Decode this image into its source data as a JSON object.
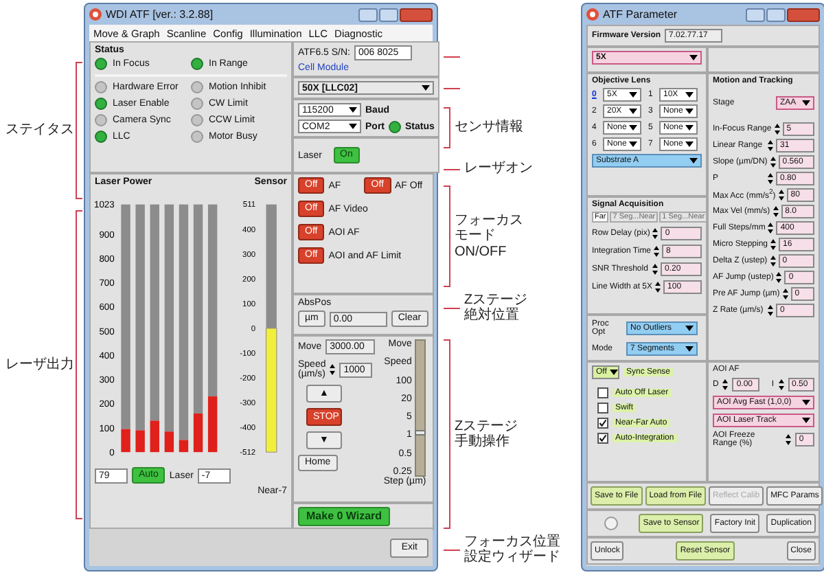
{
  "annotations_left": [
    {
      "label": "ステイタス"
    },
    {
      "label": "レーザ出力"
    }
  ],
  "annotations_middle": [
    {
      "lines": [
        "センサ情報"
      ],
      "kind": "bracket"
    },
    {
      "lines": [
        "レーザオン"
      ],
      "kind": "line"
    },
    {
      "lines": [
        "フォーカス",
        "モード",
        "ON/OFF"
      ],
      "kind": "bracket"
    },
    {
      "lines": [
        "Zステージ",
        "絶対位置"
      ],
      "kind": "line"
    },
    {
      "lines": [
        "Zステージ",
        "手動操作"
      ],
      "kind": "bracket"
    },
    {
      "lines": [
        "フォーカス位置",
        "設定ウィザード"
      ],
      "kind": "line"
    }
  ],
  "main_window": {
    "title": "WDI ATF [ver.: 3.2.88]",
    "menu": [
      "Move & Graph",
      "Scanline",
      "Config",
      "Illumination",
      "LLC",
      "Diagnostic"
    ],
    "status": {
      "title": "Status",
      "focus": [
        {
          "label": "In Focus",
          "on": true
        },
        {
          "label": "In Range",
          "on": true
        }
      ],
      "indicators": [
        {
          "label": "Hardware Error",
          "on": false
        },
        {
          "label": "Motion Inhibit",
          "on": false
        },
        {
          "label": "Laser Enable",
          "on": true
        },
        {
          "label": "CW Limit",
          "on": false
        },
        {
          "label": "Camera Sync",
          "on": false
        },
        {
          "label": "CCW Limit",
          "on": false
        },
        {
          "label": "LLC",
          "on": true
        },
        {
          "label": "Motor Busy",
          "on": false
        }
      ]
    },
    "sensor": {
      "sn_label": "ATF6.5 S/N:",
      "sn_value": "006 8025",
      "module_link": "Cell Module",
      "objective": "50X [LLC02]",
      "baud": "115200",
      "baud_label": "Baud",
      "port": "COM2",
      "port_label": "Port",
      "status_on": true,
      "status_label": "Status",
      "laser_label": "Laser",
      "laser_button": {
        "label": "On",
        "on": true
      }
    },
    "laser_power": {
      "title": "Laser Power",
      "sensor_title": "Sensor",
      "power_scale": [
        "1023",
        "900",
        "800",
        "700",
        "600",
        "500",
        "400",
        "300",
        "200",
        "100",
        "0"
      ],
      "power_bars": [
        {
          "level": 0.093
        },
        {
          "level": 0.088
        },
        {
          "level": 0.127
        },
        {
          "level": 0.083
        },
        {
          "level": 0.049
        },
        {
          "level": 0.156
        },
        {
          "level": 0.225
        }
      ],
      "sensor_meter": {
        "ticks": [
          "511",
          "400",
          "300",
          "200",
          "100",
          "0",
          "-100",
          "-200",
          "-300",
          "-400",
          "-512"
        ],
        "level": 0.5
      },
      "power_value": "79",
      "auto_button": {
        "label": "Auto",
        "on": true
      },
      "laser_label": "Laser",
      "laser_value": "-7",
      "near_label": "Near-7"
    },
    "af_modes": [
      {
        "button": "Off",
        "label": "AF"
      },
      {
        "button": "Off",
        "label": "AF Off"
      },
      {
        "button": "Off",
        "label": "AF Video"
      },
      {
        "button": "Off",
        "label": "AOI AF"
      },
      {
        "button": "Off",
        "label": "AOI and AF Limit"
      }
    ],
    "abs_pos": {
      "label": "AbsPos",
      "unit_button": "µm",
      "value": "0.00",
      "clear_button": "Clear"
    },
    "move": {
      "move_label": "Move",
      "move_value": "3000.00",
      "speed_label": "Speed\n(µm/s)",
      "speed_value": "1000",
      "up_button": "▲",
      "stop_button": "STOP",
      "down_button": "▼",
      "home_button": "Home",
      "slider_ticks": [
        "Move",
        "Speed",
        "100",
        "20",
        "5",
        "1",
        "0.5",
        "0.25"
      ],
      "slider_caption": "Step (µm)",
      "level": 0.3
    },
    "wizard_button": "Make 0 Wizard",
    "exit_button": "Exit"
  },
  "param_window": {
    "title": "ATF Parameter",
    "firmware_label": "Firmware Version",
    "firmware_value": "7.02.77.17",
    "magnification": "5X",
    "objective": {
      "title": "Objective Lens",
      "lenses": [
        {
          "index": "0",
          "value": "5X",
          "selected": true
        },
        {
          "index": "1",
          "value": "10X",
          "selected": false
        },
        {
          "index": "2",
          "value": "20X",
          "selected": false
        },
        {
          "index": "3",
          "value": "None",
          "selected": false
        },
        {
          "index": "4",
          "value": "None",
          "selected": false
        },
        {
          "index": "5",
          "value": "None",
          "selected": false
        },
        {
          "index": "6",
          "value": "None",
          "selected": false
        },
        {
          "index": "7",
          "value": "None",
          "selected": false
        }
      ],
      "substrate": "Substrate A"
    },
    "signal": {
      "title": "Signal Acquisition",
      "tabs": [
        {
          "label": "Far",
          "selected": true
        },
        {
          "label": "7 Seg...Near",
          "selected": false
        },
        {
          "label": "1 Seg...Near",
          "selected": false
        }
      ],
      "fields": [
        {
          "label": "Row Delay (pix)",
          "value": "0"
        },
        {
          "label": "Integration Time",
          "value": "8"
        },
        {
          "label": "SNR Threshold",
          "value": "0.20"
        },
        {
          "label": "Line Width at 5X",
          "value": "100"
        }
      ]
    },
    "proc_opt": {
      "label": "Proc Opt",
      "value": "No Outliers"
    },
    "mode": {
      "label": "Mode",
      "value": "7 Segments"
    },
    "motion": {
      "title": "Motion and Tracking",
      "stage_label": "Stage",
      "stage_value": "ZAA",
      "fields": [
        {
          "label": "In-Focus Range",
          "value": "5"
        },
        {
          "label": "Linear Range",
          "value": "31"
        },
        {
          "label": "Slope (µm/DN)",
          "value": "0.560"
        },
        {
          "label": "P",
          "value": "0.80"
        },
        {
          "label": "Max Acc (mm/s$^{2}$)",
          "value": "80"
        },
        {
          "label": "Max Vel (mm/s)",
          "value": "8.0"
        },
        {
          "label": "Full Steps/mm",
          "value": "400"
        },
        {
          "label": "Micro Stepping",
          "value": "16"
        },
        {
          "label": "Delta Z (ustep)",
          "value": "0"
        },
        {
          "label": "AF Jump (ustep)",
          "value": "0"
        },
        {
          "label": "Pre AF Jump (µm)",
          "value": "0"
        },
        {
          "label": "Z Rate (µm/s)",
          "value": "0"
        }
      ]
    },
    "sync": {
      "value": "Off",
      "label": "Sync Sense"
    },
    "options": [
      {
        "label": "Auto Off Laser",
        "checked": false
      },
      {
        "label": "Swift",
        "checked": false
      },
      {
        "label": "Near-Far Auto",
        "checked": true
      },
      {
        "label": "Auto-Integration",
        "checked": true
      }
    ],
    "aoi": {
      "title": "AOI AF",
      "d_label": "D",
      "d_value": "0.00",
      "i_label": "I",
      "i_value": "0.50",
      "avg": "AOI Avg Fast (1,0,0)",
      "track": "AOI Laser Track",
      "freeze_label": "AOI  Freeze Range (%)",
      "freeze_value": "0"
    },
    "button_rows": [
      [
        {
          "kind": "accent",
          "label": "Save to File",
          "disabled": false
        },
        {
          "kind": "accent",
          "label": "Load from File",
          "disabled": false
        },
        {
          "kind": "plain",
          "label": "Reflect Calib",
          "disabled": true
        },
        {
          "kind": "plain",
          "label": "MFC Params",
          "disabled": false
        }
      ],
      [
        {
          "kind": "led",
          "on": false
        },
        {
          "kind": "accent",
          "label": "Save to Sensor",
          "disabled": false
        },
        {
          "kind": "plain",
          "label": "Factory Init",
          "disabled": false
        },
        {
          "kind": "plain",
          "label": "Duplication",
          "disabled": false
        }
      ],
      [
        {
          "kind": "plain",
          "label": "Unlock",
          "disabled": false
        },
        {
          "kind": "accent",
          "label": "Reset Sensor",
          "disabled": false
        },
        {
          "kind": "plain",
          "label": "Close",
          "disabled": false
        }
      ]
    ]
  }
}
